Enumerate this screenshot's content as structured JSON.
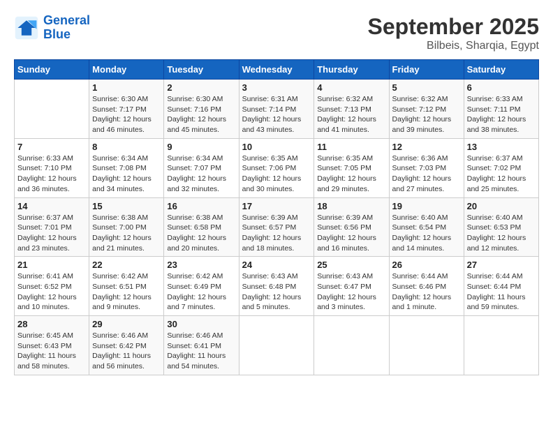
{
  "header": {
    "logo_line1": "General",
    "logo_line2": "Blue",
    "month_title": "September 2025",
    "location": "Bilbeis, Sharqia, Egypt"
  },
  "weekdays": [
    "Sunday",
    "Monday",
    "Tuesday",
    "Wednesday",
    "Thursday",
    "Friday",
    "Saturday"
  ],
  "weeks": [
    [
      {
        "day": "",
        "info": ""
      },
      {
        "day": "1",
        "info": "Sunrise: 6:30 AM\nSunset: 7:17 PM\nDaylight: 12 hours\nand 46 minutes."
      },
      {
        "day": "2",
        "info": "Sunrise: 6:30 AM\nSunset: 7:16 PM\nDaylight: 12 hours\nand 45 minutes."
      },
      {
        "day": "3",
        "info": "Sunrise: 6:31 AM\nSunset: 7:14 PM\nDaylight: 12 hours\nand 43 minutes."
      },
      {
        "day": "4",
        "info": "Sunrise: 6:32 AM\nSunset: 7:13 PM\nDaylight: 12 hours\nand 41 minutes."
      },
      {
        "day": "5",
        "info": "Sunrise: 6:32 AM\nSunset: 7:12 PM\nDaylight: 12 hours\nand 39 minutes."
      },
      {
        "day": "6",
        "info": "Sunrise: 6:33 AM\nSunset: 7:11 PM\nDaylight: 12 hours\nand 38 minutes."
      }
    ],
    [
      {
        "day": "7",
        "info": "Sunrise: 6:33 AM\nSunset: 7:10 PM\nDaylight: 12 hours\nand 36 minutes."
      },
      {
        "day": "8",
        "info": "Sunrise: 6:34 AM\nSunset: 7:08 PM\nDaylight: 12 hours\nand 34 minutes."
      },
      {
        "day": "9",
        "info": "Sunrise: 6:34 AM\nSunset: 7:07 PM\nDaylight: 12 hours\nand 32 minutes."
      },
      {
        "day": "10",
        "info": "Sunrise: 6:35 AM\nSunset: 7:06 PM\nDaylight: 12 hours\nand 30 minutes."
      },
      {
        "day": "11",
        "info": "Sunrise: 6:35 AM\nSunset: 7:05 PM\nDaylight: 12 hours\nand 29 minutes."
      },
      {
        "day": "12",
        "info": "Sunrise: 6:36 AM\nSunset: 7:03 PM\nDaylight: 12 hours\nand 27 minutes."
      },
      {
        "day": "13",
        "info": "Sunrise: 6:37 AM\nSunset: 7:02 PM\nDaylight: 12 hours\nand 25 minutes."
      }
    ],
    [
      {
        "day": "14",
        "info": "Sunrise: 6:37 AM\nSunset: 7:01 PM\nDaylight: 12 hours\nand 23 minutes."
      },
      {
        "day": "15",
        "info": "Sunrise: 6:38 AM\nSunset: 7:00 PM\nDaylight: 12 hours\nand 21 minutes."
      },
      {
        "day": "16",
        "info": "Sunrise: 6:38 AM\nSunset: 6:58 PM\nDaylight: 12 hours\nand 20 minutes."
      },
      {
        "day": "17",
        "info": "Sunrise: 6:39 AM\nSunset: 6:57 PM\nDaylight: 12 hours\nand 18 minutes."
      },
      {
        "day": "18",
        "info": "Sunrise: 6:39 AM\nSunset: 6:56 PM\nDaylight: 12 hours\nand 16 minutes."
      },
      {
        "day": "19",
        "info": "Sunrise: 6:40 AM\nSunset: 6:54 PM\nDaylight: 12 hours\nand 14 minutes."
      },
      {
        "day": "20",
        "info": "Sunrise: 6:40 AM\nSunset: 6:53 PM\nDaylight: 12 hours\nand 12 minutes."
      }
    ],
    [
      {
        "day": "21",
        "info": "Sunrise: 6:41 AM\nSunset: 6:52 PM\nDaylight: 12 hours\nand 10 minutes."
      },
      {
        "day": "22",
        "info": "Sunrise: 6:42 AM\nSunset: 6:51 PM\nDaylight: 12 hours\nand 9 minutes."
      },
      {
        "day": "23",
        "info": "Sunrise: 6:42 AM\nSunset: 6:49 PM\nDaylight: 12 hours\nand 7 minutes."
      },
      {
        "day": "24",
        "info": "Sunrise: 6:43 AM\nSunset: 6:48 PM\nDaylight: 12 hours\nand 5 minutes."
      },
      {
        "day": "25",
        "info": "Sunrise: 6:43 AM\nSunset: 6:47 PM\nDaylight: 12 hours\nand 3 minutes."
      },
      {
        "day": "26",
        "info": "Sunrise: 6:44 AM\nSunset: 6:46 PM\nDaylight: 12 hours\nand 1 minute."
      },
      {
        "day": "27",
        "info": "Sunrise: 6:44 AM\nSunset: 6:44 PM\nDaylight: 11 hours\nand 59 minutes."
      }
    ],
    [
      {
        "day": "28",
        "info": "Sunrise: 6:45 AM\nSunset: 6:43 PM\nDaylight: 11 hours\nand 58 minutes."
      },
      {
        "day": "29",
        "info": "Sunrise: 6:46 AM\nSunset: 6:42 PM\nDaylight: 11 hours\nand 56 minutes."
      },
      {
        "day": "30",
        "info": "Sunrise: 6:46 AM\nSunset: 6:41 PM\nDaylight: 11 hours\nand 54 minutes."
      },
      {
        "day": "",
        "info": ""
      },
      {
        "day": "",
        "info": ""
      },
      {
        "day": "",
        "info": ""
      },
      {
        "day": "",
        "info": ""
      }
    ]
  ]
}
